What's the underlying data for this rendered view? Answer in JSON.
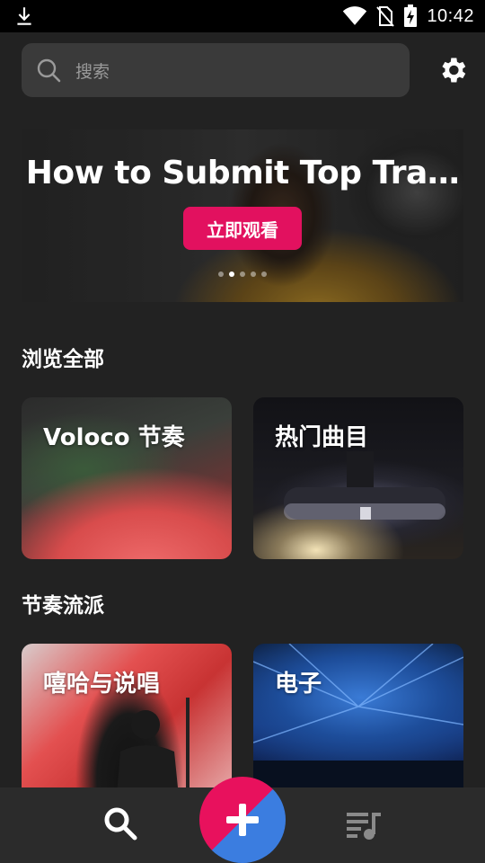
{
  "status_bar": {
    "time": "10:42",
    "icons": [
      "download-icon",
      "wifi-icon",
      "no-sim-icon",
      "battery-charging-icon"
    ]
  },
  "search": {
    "placeholder": "搜索",
    "icon": "search-icon"
  },
  "settings": {
    "icon": "gear-icon"
  },
  "banner": {
    "title": "How to Submit Top Tra…",
    "button_label": "立即观看",
    "dots_total": 5,
    "dots_active_index": 1
  },
  "browse_section": {
    "title": "浏览全部",
    "cards": [
      {
        "label": "Voloco 节奏"
      },
      {
        "label": "热门曲目"
      }
    ]
  },
  "genre_section": {
    "title": "节奏流派",
    "cards": [
      {
        "label": "嘻哈与说唱"
      },
      {
        "label": "电子"
      }
    ]
  },
  "bottom_nav": {
    "items": [
      "search-icon",
      "add-icon",
      "playlist-icon"
    ],
    "colors": {
      "fab_pink": "#e8115d",
      "fab_blue": "#3b7de0"
    }
  },
  "colors": {
    "accent": "#e2115f",
    "background": "#222222",
    "search_bg": "#3a3a3a"
  }
}
